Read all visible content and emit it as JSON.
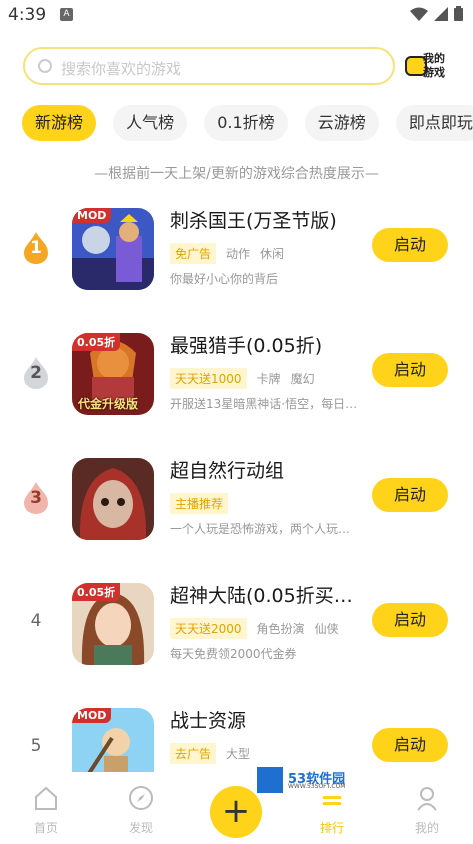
{
  "status_bar": {
    "time": "4:39",
    "notif": "A"
  },
  "search": {
    "placeholder": "搜索你喜欢的游戏"
  },
  "my_games": {
    "line1": "我的",
    "line2": "游戏"
  },
  "tabs": [
    {
      "label": "新游榜",
      "active": true
    },
    {
      "label": "人气榜",
      "active": false
    },
    {
      "label": "0.1折榜",
      "active": false
    },
    {
      "label": "云游榜",
      "active": false
    },
    {
      "label": "即点即玩",
      "active": false
    }
  ],
  "subtitle": "—根据前一天上架/更新的游戏综合热度展示—",
  "games": [
    {
      "rank": "1",
      "title": "刺杀国王(万圣节版)",
      "badge": "MOD",
      "tag": "免广告",
      "cats": [
        "动作",
        "休闲"
      ],
      "desc": "你最好小心你的背后",
      "button": "启动"
    },
    {
      "rank": "2",
      "title": "最强猎手(0.05折)",
      "badge": "0.05折",
      "tag": "天天送1000",
      "cats": [
        "卡牌",
        "魔幻"
      ],
      "desc": "开服送13星暗黑神话·悟空，每日…",
      "button": "启动"
    },
    {
      "rank": "3",
      "title": "超自然行动组",
      "badge": "",
      "tag": "主播推荐",
      "cats": [],
      "desc": "一个人玩是恐怖游戏，两个人玩…",
      "button": "启动"
    },
    {
      "rank": "4",
      "title": "超神大陆(0.05折买…",
      "badge": "0.05折",
      "tag": "天天送2000",
      "cats": [
        "角色扮演",
        "仙侠"
      ],
      "desc": "每天免费领2000代金券",
      "button": "启动"
    },
    {
      "rank": "5",
      "title": "战士资源",
      "badge": "MOD",
      "tag": "去广告",
      "cats": [
        "大型"
      ],
      "desc": "",
      "button": "启动"
    }
  ],
  "icon_overlay_text": {
    "game2": "代金升级版"
  },
  "bottom_nav": [
    {
      "label": "首页",
      "icon": "home-icon"
    },
    {
      "label": "发现",
      "icon": "compass-icon"
    },
    {
      "label": "",
      "icon": "plus-icon"
    },
    {
      "label": "排行",
      "icon": "ranking-icon"
    },
    {
      "label": "我的",
      "icon": "user-icon"
    }
  ],
  "watermark": {
    "title": "53软件园",
    "url": "WWW.53SOFT.COM"
  },
  "colors": {
    "accent": "#ffd31a",
    "tag_text": "#e0a400",
    "tag_bg": "#fff6cf"
  }
}
